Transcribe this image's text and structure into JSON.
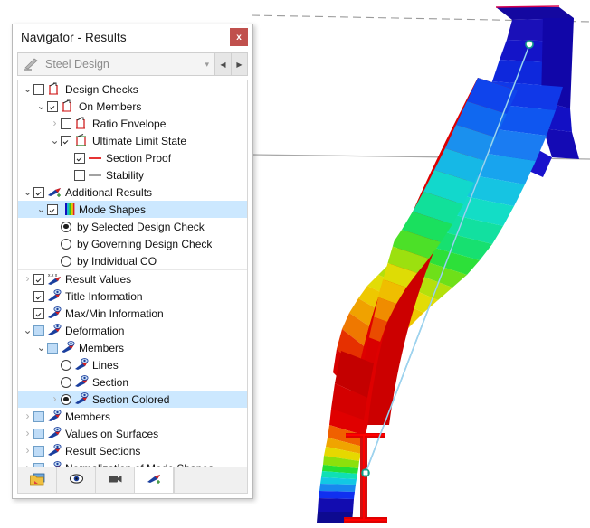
{
  "window": {
    "title": "Navigator - Results",
    "close_label": "x",
    "close_icon": "close-icon"
  },
  "combo": {
    "icon": "steel-design-icon",
    "value": "Steel Design",
    "chevron_icon": "chevron-down-icon",
    "prev_label": "◀",
    "next_label": "▶",
    "disabled": true
  },
  "tree": [
    {
      "id": "design-checks",
      "label": "Design Checks",
      "indent": 0,
      "expander": "down",
      "control": "checkbox",
      "state": "unchecked",
      "icon": "design-check-icon",
      "selected": false
    },
    {
      "id": "on-members",
      "label": "On Members",
      "indent": 1,
      "expander": "down",
      "control": "checkbox",
      "state": "checked",
      "icon": "design-check-icon",
      "selected": false
    },
    {
      "id": "ratio-envelope",
      "label": "Ratio Envelope",
      "indent": 2,
      "expander": "right-muted",
      "control": "checkbox",
      "state": "unchecked",
      "icon": "design-check-icon",
      "selected": false
    },
    {
      "id": "ultimate-limit-state",
      "label": "Ultimate Limit State",
      "indent": 2,
      "expander": "down",
      "control": "checkbox",
      "state": "checked",
      "icon": "limit-state-icon",
      "selected": false
    },
    {
      "id": "section-proof",
      "label": "Section Proof",
      "indent": 3,
      "expander": "none",
      "control": "checkbox",
      "state": "checked",
      "icon": "red-line-icon",
      "selected": false
    },
    {
      "id": "stability",
      "label": "Stability",
      "indent": 3,
      "expander": "none",
      "control": "checkbox",
      "state": "unchecked",
      "icon": "gray-line-icon",
      "selected": false
    },
    {
      "id": "additional-results",
      "label": "Additional Results",
      "indent": 0,
      "expander": "down",
      "control": "checkbox",
      "state": "checked",
      "icon": "results-arrow-icon",
      "selected": false
    },
    {
      "id": "mode-shapes",
      "label": "Mode Shapes",
      "indent": 1,
      "expander": "down",
      "control": "checkbox",
      "state": "checked",
      "icon": "mode-shape-icon",
      "selected": true
    },
    {
      "id": "by-selected-design-check",
      "label": "by Selected Design Check",
      "indent": 2,
      "expander": "none",
      "control": "radio",
      "state": "on",
      "icon": "none",
      "selected": false
    },
    {
      "id": "by-governing-design-check",
      "label": "by Governing Design Check",
      "indent": 2,
      "expander": "none",
      "control": "radio",
      "state": "off",
      "icon": "none",
      "selected": false
    },
    {
      "id": "by-individual-co",
      "label": "by Individual CO",
      "indent": 2,
      "expander": "none",
      "control": "radio",
      "state": "off",
      "icon": "none",
      "selected": false
    },
    {
      "id": "result-values",
      "label": "Result Values",
      "indent": 0,
      "expander": "right-muted",
      "control": "checkbox",
      "state": "checked",
      "icon": "result-values-icon",
      "selected": false,
      "separator": true
    },
    {
      "id": "title-information",
      "label": "Title Information",
      "indent": 0,
      "expander": "none",
      "control": "checkbox",
      "state": "checked",
      "icon": "eye-arrow-icon",
      "selected": false
    },
    {
      "id": "max-min-information",
      "label": "Max/Min Information",
      "indent": 0,
      "expander": "none",
      "control": "checkbox",
      "state": "checked",
      "icon": "eye-arrow-icon",
      "selected": false
    },
    {
      "id": "deformation",
      "label": "Deformation",
      "indent": 0,
      "expander": "down",
      "control": "checkbox",
      "state": "tristate",
      "icon": "eye-arrow-icon",
      "selected": false
    },
    {
      "id": "members-sub",
      "label": "Members",
      "indent": 1,
      "expander": "down",
      "control": "checkbox",
      "state": "tristate",
      "icon": "eye-arrow-icon",
      "selected": false
    },
    {
      "id": "lines",
      "label": "Lines",
      "indent": 2,
      "expander": "none",
      "control": "radio",
      "state": "off",
      "icon": "eye-arrow-icon",
      "selected": false
    },
    {
      "id": "section",
      "label": "Section",
      "indent": 2,
      "expander": "none",
      "control": "radio",
      "state": "off",
      "icon": "eye-arrow-icon",
      "selected": false
    },
    {
      "id": "section-colored",
      "label": "Section Colored",
      "indent": 2,
      "expander": "right-muted",
      "control": "radio",
      "state": "on",
      "icon": "eye-arrow-icon",
      "selected": true
    },
    {
      "id": "members",
      "label": "Members",
      "indent": 0,
      "expander": "right-muted",
      "control": "checkbox",
      "state": "tristate",
      "icon": "eye-arrow-icon",
      "selected": false
    },
    {
      "id": "values-on-surfaces",
      "label": "Values on Surfaces",
      "indent": 0,
      "expander": "right-muted",
      "control": "checkbox",
      "state": "tristate",
      "icon": "eye-arrow-icon",
      "selected": false
    },
    {
      "id": "result-sections",
      "label": "Result Sections",
      "indent": 0,
      "expander": "right-muted",
      "control": "checkbox",
      "state": "tristate",
      "icon": "eye-arrow-icon",
      "selected": false
    },
    {
      "id": "normalization-of-mode-shapes",
      "label": "Normalization of Mode Shapes",
      "indent": 0,
      "expander": "right-muted",
      "control": "checkbox",
      "state": "tristate",
      "icon": "eye-arrow-icon",
      "selected": false
    }
  ],
  "toolbar": [
    {
      "id": "project-navigator",
      "icon": "folder-image-icon",
      "active": false
    },
    {
      "id": "display-navigator",
      "icon": "eye-icon",
      "active": false
    },
    {
      "id": "views-navigator",
      "icon": "video-camera-icon",
      "active": false
    },
    {
      "id": "results-navigator",
      "icon": "results-arrow-icon",
      "active": true
    }
  ],
  "viewport": {
    "name": "mode-shape-3d-view",
    "background": "#ffffff",
    "guide_line_top_style": "dashed",
    "guide_line_mid_style": "solid",
    "guide_color": "#8c8c8c",
    "node_marker_color": "#13a089",
    "undeformed_line_color": "#7ec3e8",
    "section_outline_color": "#e00000",
    "colors": [
      "#0c0c8c",
      "#0000e0",
      "#0050f0",
      "#0090f0",
      "#00c8e0",
      "#00e0c0",
      "#00e070",
      "#30e030",
      "#90e000",
      "#d8e000",
      "#f0d000",
      "#f09000",
      "#f05000",
      "#e00000",
      "#b00000"
    ]
  }
}
